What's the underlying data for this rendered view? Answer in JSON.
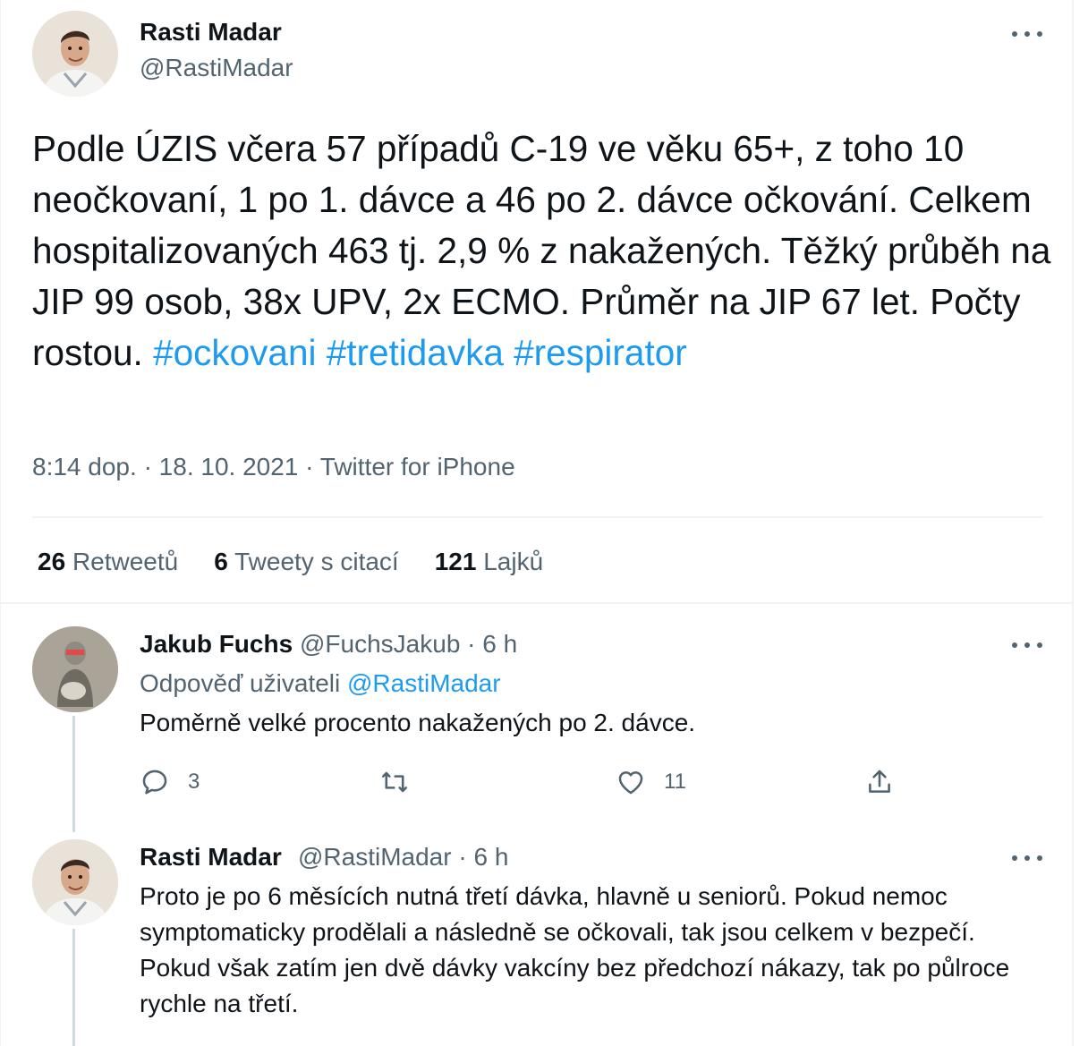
{
  "main_tweet": {
    "author_name": "Rasti Madar",
    "author_handle": "@RastiMadar",
    "text": "Podle ÚZIS včera 57 případů C-19 ve věku 65+, z toho 10 neočkovaní, 1 po 1. dávce a 46 po 2. dávce očkování. Celkem hospitalizovaných 463 tj. 2,9 % z nakažených. Těžký průběh na JIP 99 osob, 38x UPV, 2x ECMO. Průměr na JIP 67 let. Počty rostou.",
    "hashtags": [
      "#ockovani",
      "#tretidavka",
      "#respirator"
    ],
    "time": "8:14 dop.",
    "separator": "·",
    "date": "18. 10. 2021",
    "source": "Twitter for iPhone",
    "stats": {
      "retweets_count": "26",
      "retweets_label": "Retweetů",
      "quotes_count": "6",
      "quotes_label": "Tweety s citací",
      "likes_count": "121",
      "likes_label": "Lajků"
    }
  },
  "reply_1": {
    "author_name": "Jakub Fuchs",
    "author_handle": "@FuchsJakub",
    "separator": "·",
    "time": "6 h",
    "replying_to_label": "Odpověď uživateli",
    "replying_to_handle": "@RastiMadar",
    "text": "Poměrně velké procento nakažených po 2. dávce.",
    "actions": {
      "reply_count": "3",
      "retweet_count": "",
      "like_count": "11"
    },
    "icons": [
      "reply-icon",
      "retweet-icon",
      "like-icon",
      "share-icon"
    ]
  },
  "reply_2": {
    "author_name": "Rasti Madar",
    "author_handle": "@RastiMadar",
    "separator": "·",
    "time": "6 h",
    "text": "Proto je po 6 měsících nutná třetí dávka, hlavně u seniorů. Pokud nemoc symptomaticky prodělali a následně se očkovali, tak jsou celkem v bezpečí. Pokud však zatím jen dvě dávky vakcíny bez předchozí nákazy, tak po půlroce rychle na třetí."
  },
  "colors": {
    "link": "#1d9bf0",
    "secondary_text": "#536471",
    "primary_text": "#0f1419",
    "divider": "#eff3f4"
  }
}
